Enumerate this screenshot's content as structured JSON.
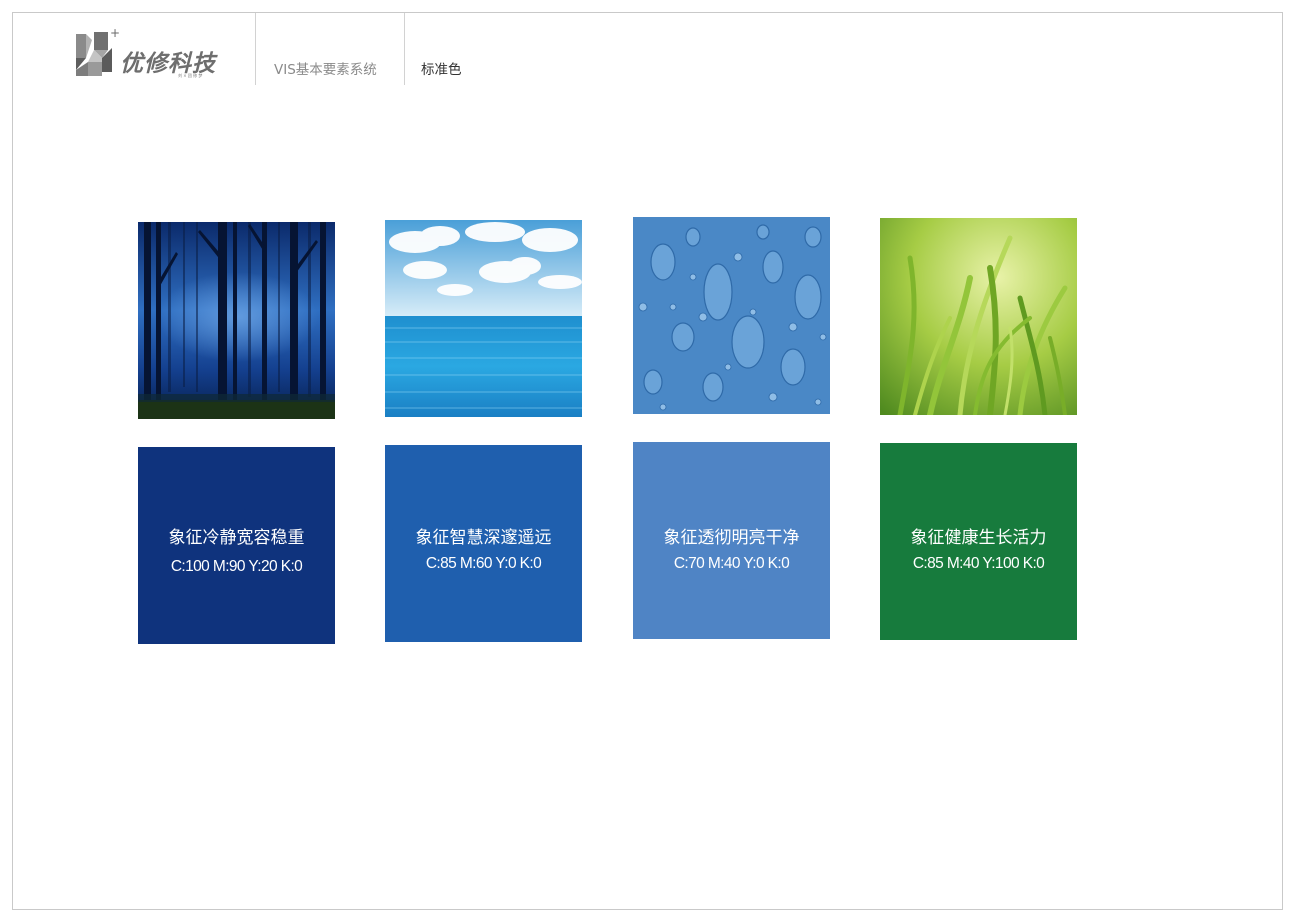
{
  "header": {
    "brand_name": "优修科技",
    "brand_tagline": "刘 × 团 修 梦",
    "system_title": "VIS基本要素系统",
    "section_title": "标准色"
  },
  "colors": [
    {
      "photo_subject": "misty blue forest",
      "description": "象征冷静宽容稳重",
      "cmyk": "C:100  M:90  Y:20  K:0",
      "hex": "#0f337d"
    },
    {
      "photo_subject": "sky and ocean",
      "description": "象征智慧深邃遥远",
      "cmyk": "C:85  M:60  Y:0  K:0",
      "hex": "#1f5fae"
    },
    {
      "photo_subject": "water droplets",
      "description": "象征透彻明亮干净",
      "cmyk": "C:70  M:40  Y:0  K:0",
      "hex": "#4f84c5"
    },
    {
      "photo_subject": "fresh green grass",
      "description": "象征健康生长活力",
      "cmyk": "C:85  M:40  Y:100  K:0",
      "hex": "#177b3d"
    }
  ]
}
